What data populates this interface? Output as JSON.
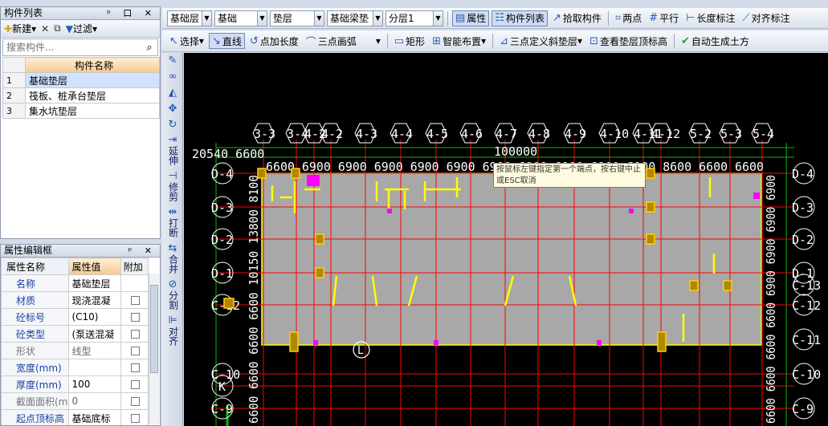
{
  "component_panel": {
    "title": "构件列表",
    "title_buttons": "ᵖ 口 ✕",
    "new_label": "新建",
    "filter_label": "过滤",
    "search_placeholder": "搜索构件...",
    "column_header": "构件名称",
    "rows": [
      {
        "idx": "1",
        "name": "基础垫层"
      },
      {
        "idx": "2",
        "name": "筏板、桩承台垫层"
      },
      {
        "idx": "3",
        "name": "集水坑垫层"
      }
    ]
  },
  "property_panel": {
    "title": "属性编辑框",
    "title_buttons": "ᵖ ✕",
    "headers": [
      "属性名称",
      "属性值",
      "附加"
    ],
    "rows": [
      {
        "key": "名称",
        "value": "基础垫层"
      },
      {
        "key": "材质",
        "value": "现浇混凝"
      },
      {
        "key": "砼标号",
        "value": "(C10)"
      },
      {
        "key": "砼类型",
        "value": "(泵送混凝"
      },
      {
        "key": "形状",
        "value": "线型"
      },
      {
        "key": "宽度(mm)",
        "value": ""
      },
      {
        "key": "厚度(mm)",
        "value": "100"
      },
      {
        "key": "截面面积(m",
        "value": "0"
      },
      {
        "key": "起点顶标高",
        "value": "基础底标"
      }
    ]
  },
  "toolbar1": {
    "layer": "基础层",
    "category": "基础",
    "type": "垫层",
    "component": "基础梁垫",
    "sublayer": "分层1",
    "properties": "属性",
    "component_list": "构件列表",
    "pick": "拾取构件",
    "two_points": "两点",
    "parallel": "平行",
    "length_dim": "长度标注",
    "align_dim": "对齐标注"
  },
  "toolbar2": {
    "select": "选择",
    "line": "直线",
    "point_length": "点加长度",
    "arc3": "三点画弧",
    "rect": "矩形",
    "smart": "智能布置",
    "slope3": "三点定义斜垫层",
    "view_top": "查看垫层顶标高",
    "auto_earth": "自动生成土方"
  },
  "vertical_tools": {
    "extend": "延伸",
    "trim": "修剪",
    "break": "打断",
    "merge": "合并",
    "split": "分割",
    "align": "对齐"
  },
  "canvas": {
    "tooltip": "按鼠标左键指定第一个端点，按右键中止或ESC取消",
    "top_axes": [
      "3-3",
      "3-4",
      "4-2",
      "4-2",
      "4-3",
      "4-4",
      "4-5",
      "4-6",
      "4-7",
      "4-8",
      "4-9",
      "4-10",
      "4-11",
      "4-12",
      "5-2",
      "5-3",
      "5-4"
    ],
    "left_axes": [
      "D-4",
      "D-3",
      "D-2",
      "D-1",
      "C-12",
      "C-10",
      "K",
      "C-9"
    ],
    "right_axes": [
      "D-4",
      "D-3",
      "D-2",
      "D-1",
      "C-13",
      "C-12",
      "C-11",
      "C-10",
      "C-9"
    ],
    "dim_text_top": "6600 6900 6900 6900 6900 6900 6900 6900 6900 6900 6900 8600 6600 6600",
    "dim_total": "100000",
    "dim_left_top": "20540 6600",
    "dim_left_vert": "6600 6600 6600 6600 10150 13800 8100",
    "dim_right_vert": "6600 6600 6600 6600 6900 6900 6900 6900",
    "point_label": "L",
    "colors": {
      "slab": "#a8a8a8",
      "axis": "#ff0000",
      "grid": "#00c000",
      "wall": "#ffff00",
      "marker": "#ff00ff"
    }
  }
}
